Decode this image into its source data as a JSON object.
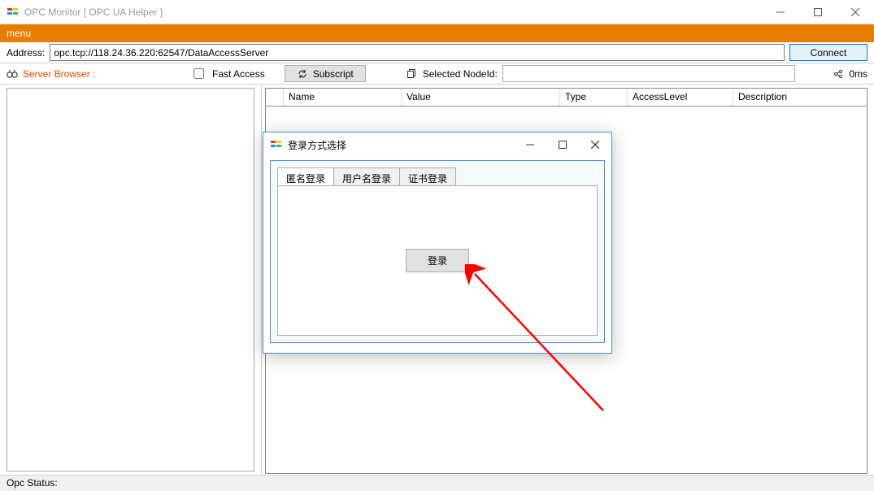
{
  "window": {
    "title": "OPC Monitor [ OPC UA Helper ]"
  },
  "menubar": {
    "menu_label": "menu"
  },
  "addressbar": {
    "label": "Address:",
    "value": "opc.tcp://118.24.36.220:62547/DataAccessServer",
    "connect_label": "Connect"
  },
  "toolbar": {
    "server_browser_label": "Server Browser :",
    "fast_access_label": "Fast Access",
    "fast_access_checked": false,
    "subscript_label": "Subscript",
    "selected_nodeid_label": "Selected NodeId:",
    "selected_nodeid_value": "",
    "latency_label": "0ms"
  },
  "table": {
    "headers": {
      "name": "Name",
      "value": "Value",
      "type": "Type",
      "access_level": "AccessLevel",
      "description": "Description"
    }
  },
  "dialog": {
    "title": "登录方式选择",
    "tabs": {
      "anonymous": "匿名登录",
      "username": "用户名登录",
      "certificate": "证书登录"
    },
    "active_tab": "anonymous",
    "login_button": "登录"
  },
  "statusbar": {
    "label": "Opc Status:"
  }
}
